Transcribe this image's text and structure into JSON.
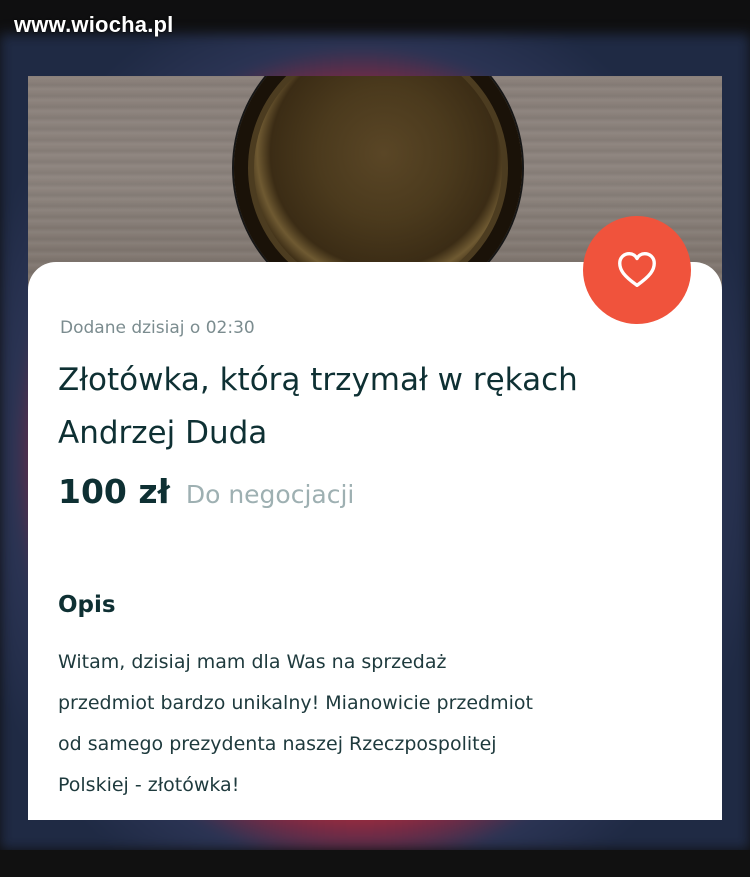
{
  "watermark": "www.wiocha.pl",
  "listing": {
    "date": "Dodane dzisiaj o 02:30",
    "title_line1": "Złotówka, którą trzymał w rękach",
    "title_line2": "Andrzej Duda",
    "price": "100 zł",
    "negotiable": "Do negocjacji",
    "favorite_icon": "heart-icon",
    "photo_subject": "coin-photo"
  },
  "description": {
    "heading": "Opis",
    "line1": "Witam, dzisiaj mam dla Was na sprzedaż",
    "line2": "przedmiot bardzo unikalny! Mianowicie przedmiot",
    "line3": "od samego prezydenta naszej Rzeczpospolitej",
    "line4": "Polskiej - złotówka!"
  },
  "colors": {
    "accent": "#f0533c",
    "title": "#0e3033",
    "muted": "#9eb0b2"
  }
}
